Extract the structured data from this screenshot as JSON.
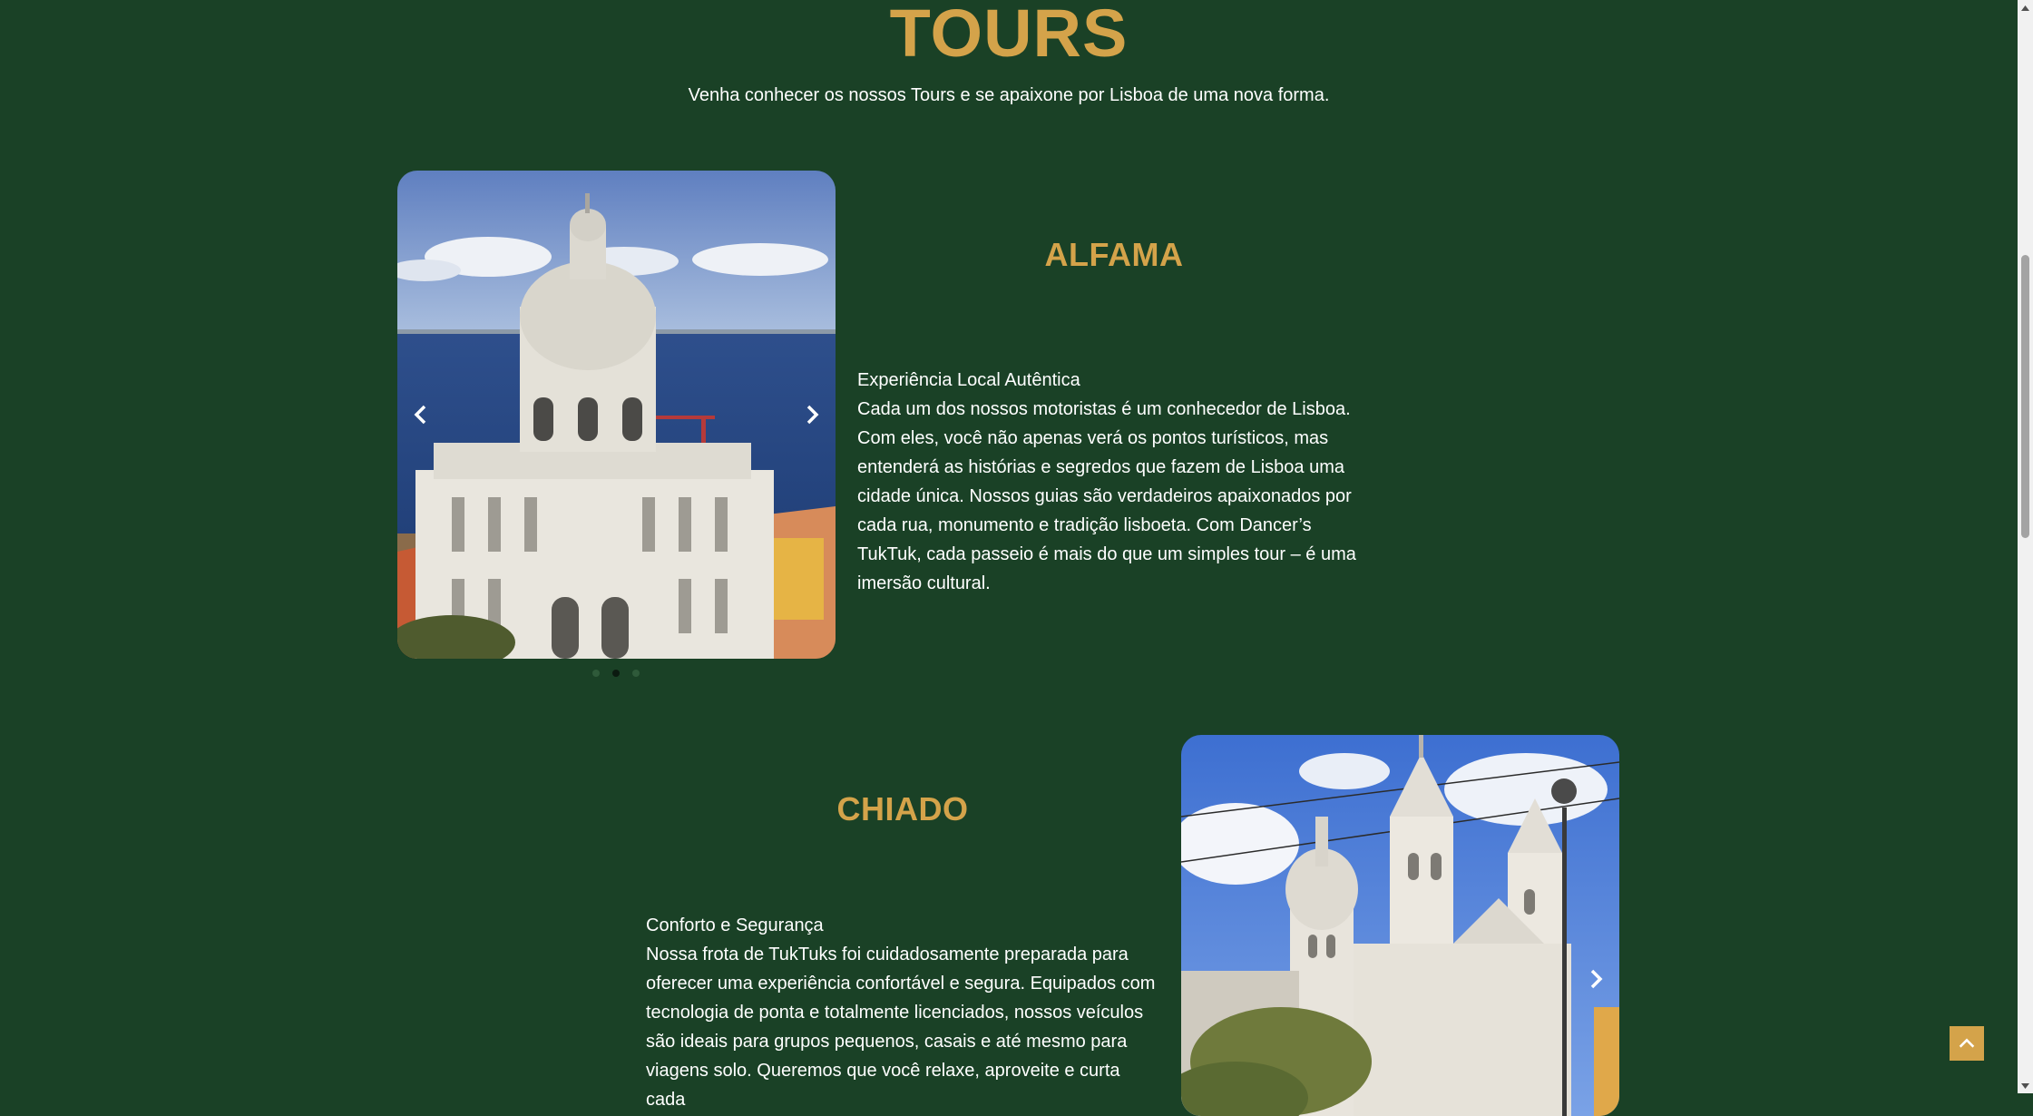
{
  "header": {
    "title": "TOURS",
    "subtitle": "Venha conhecer os nossos Tours e se apaixone por Lisboa de uma nova forma."
  },
  "sections": [
    {
      "title": "ALFAMA",
      "heading": "Experiência Local Autêntica",
      "body": "Cada um dos nossos motoristas é um conhecedor de Lisboa. Com eles, você não apenas verá os pontos turísticos, mas entenderá as histórias e segredos que fazem de Lisboa uma cidade única. Nossos guias são verdadeiros apaixonados por cada rua, monumento e tradição lisboeta. Com Dancer’s TukTuk, cada passeio é mais do que um simples tour – é uma imersão cultural.",
      "carousel": {
        "active_slide": 2,
        "total_slides": 3,
        "prev_icon": "chevron-left-icon",
        "next_icon": "chevron-right-icon"
      }
    },
    {
      "title": "CHIADO",
      "heading": "Conforto e Segurança",
      "body": "Nossa frota de TukTuks foi cuidadosamente preparada para oferecer uma experiência confortável e segura. Equipados com tecnologia de ponta e totalmente licenciados, nossos veículos são ideais para grupos pequenos, casais e até mesmo para viagens solo. Queremos que você relaxe, aproveite e curta cada",
      "carousel": {
        "next_icon": "chevron-right-icon"
      }
    }
  ],
  "colors": {
    "background": "#1a4126",
    "accent": "#d4a34a",
    "text": "#ffffff"
  },
  "back_to_top_icon": "chevron-up-icon"
}
